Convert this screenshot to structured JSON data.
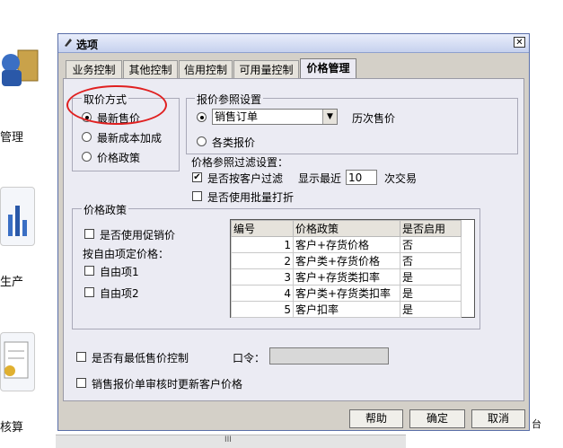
{
  "background": {
    "labels": [
      "管理",
      "生产",
      "核算"
    ],
    "status_char": "台",
    "scroll_grip": "III"
  },
  "dialog": {
    "title": "选项",
    "close_glyph": "✕",
    "tabs": [
      {
        "label": "业务控制",
        "active": false
      },
      {
        "label": "其他控制",
        "active": false
      },
      {
        "label": "信用控制",
        "active": false
      },
      {
        "label": "可用量控制",
        "active": false
      },
      {
        "label": "价格管理",
        "active": true
      }
    ]
  },
  "price_method": {
    "title": "取价方式",
    "options": [
      {
        "label": "最新售价",
        "selected": true
      },
      {
        "label": "最新成本加成",
        "selected": false
      },
      {
        "label": "价格政策",
        "selected": false
      }
    ]
  },
  "quote_ref": {
    "title": "报价参照设置",
    "option1_selected": true,
    "select_value": "销售订单",
    "history_label": "历次售价",
    "option2_label": "各类报价",
    "option2_selected": false
  },
  "filter": {
    "title": "价格参照过滤设置：",
    "by_customer_label": "是否按客户过滤",
    "by_customer_checked": true,
    "recent_label": "显示最近",
    "recent_value": "10",
    "trans_label": "次交易",
    "batch_label": "是否使用批量打折",
    "batch_checked": false
  },
  "policy": {
    "title": "价格政策",
    "promo_label": "是否使用促销价",
    "promo_checked": false,
    "custom_label": "按自由项定价格：",
    "free1_label": "自由项1",
    "free2_label": "自由项2",
    "table": {
      "headers": [
        "编号",
        "价格政策",
        "是否启用"
      ],
      "rows": [
        [
          "1",
          "客户+存货价格",
          "否"
        ],
        [
          "2",
          "客户类+存货价格",
          "否"
        ],
        [
          "3",
          "客户+存货类扣率",
          "是"
        ],
        [
          "4",
          "客户类+存货类扣率",
          "是"
        ],
        [
          "5",
          "客户扣率",
          "是"
        ]
      ]
    }
  },
  "min_price_label": "是否有最低售价控制",
  "min_price_checked": false,
  "password_label": "口令：",
  "password_value": "",
  "update_price_label": "销售报价单审核时更新客户价格",
  "update_price_checked": false,
  "buttons": {
    "help": "帮助",
    "ok": "确定",
    "cancel": "取消"
  },
  "colors": {
    "highlight_oval": "#e02020",
    "panel": "#ebebf3",
    "dialog": "#d4d0c8"
  }
}
